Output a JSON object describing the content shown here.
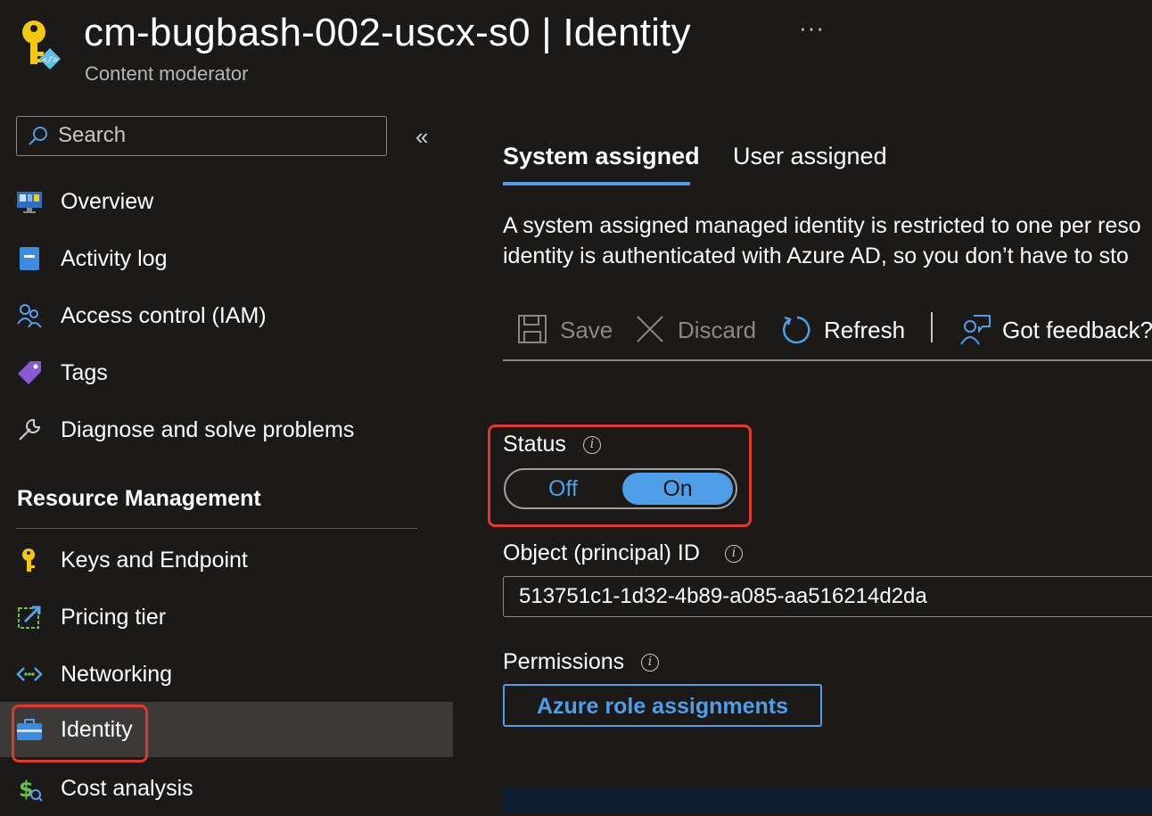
{
  "header": {
    "title": "cm-bugbash-002-uscx-s0 | Identity",
    "subtitle": "Content moderator",
    "more_label": "···"
  },
  "sidebar": {
    "search": {
      "placeholder": "Search",
      "value": ""
    },
    "collapse_label": "«",
    "items": [
      {
        "label": "Overview",
        "icon": "overview-icon"
      },
      {
        "label": "Activity log",
        "icon": "activity-log-icon"
      },
      {
        "label": "Access control (IAM)",
        "icon": "people-icon"
      },
      {
        "label": "Tags",
        "icon": "tag-icon"
      },
      {
        "label": "Diagnose and solve problems",
        "icon": "wrench-icon"
      }
    ],
    "section_title": "Resource Management",
    "section_items": [
      {
        "label": "Keys and Endpoint",
        "icon": "key-icon"
      },
      {
        "label": "Pricing tier",
        "icon": "pricing-icon"
      },
      {
        "label": "Networking",
        "icon": "networking-icon"
      },
      {
        "label": "Identity",
        "icon": "identity-icon",
        "selected": true
      },
      {
        "label": "Cost analysis",
        "icon": "cost-icon"
      }
    ]
  },
  "main": {
    "tabs": [
      {
        "label": "System assigned",
        "active": true
      },
      {
        "label": "User assigned",
        "active": false
      }
    ],
    "description_line1": "A system assigned managed identity is restricted to one per reso",
    "description_line2": "identity is authenticated with Azure AD, so you don’t have to sto",
    "toolbar": {
      "save_label": "Save",
      "discard_label": "Discard",
      "refresh_label": "Refresh",
      "feedback_label": "Got feedback?"
    },
    "status": {
      "label": "Status",
      "info": "i",
      "off_label": "Off",
      "on_label": "On",
      "value": "On"
    },
    "object_id": {
      "label": "Object (principal) ID",
      "info": "i",
      "value": "513751c1-1d32-4b89-a085-aa516214d2da"
    },
    "permissions": {
      "label": "Permissions",
      "info": "i",
      "button_label": "Azure role assignments"
    }
  },
  "colors": {
    "background": "#1b1a19",
    "accent": "#4f9ee8",
    "selected_bg": "#3b3a39",
    "highlight": "#e0382a"
  }
}
